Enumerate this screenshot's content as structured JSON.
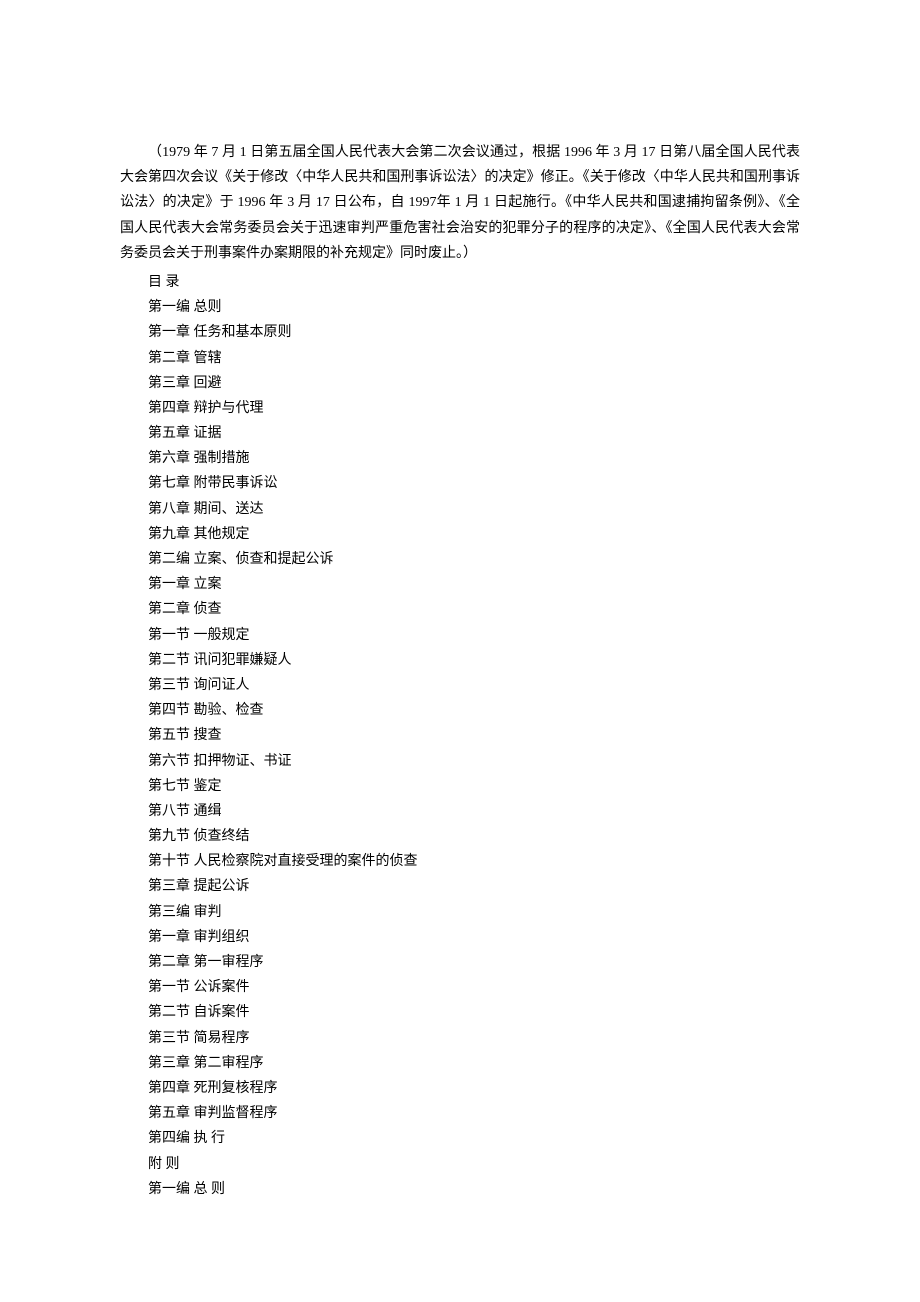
{
  "intro": "（1979 年 7 月 1 日第五届全国人民代表大会第二次会议通过，根据 1996 年 3 月 17 日第八届全国人民代表大会第四次会议《关于修改〈中华人民共和国刑事诉讼法〉的决定》修正。《关于修改〈中华人民共和国刑事诉讼法〉的决定》于 1996 年 3 月 17 日公布，自 1997年 1 月 1 日起施行。《中华人民共和国逮捕拘留条例》、《全国人民代表大会常务委员会关于迅速审判严重危害社会治安的犯罪分子的程序的决定》、《全国人民代表大会常务委员会关于刑事案件办案期限的补充规定》同时废止。）",
  "toc": [
    "目  录",
    "第一编  总则",
    "第一章  任务和基本原则",
    "第二章  管辖",
    "第三章  回避",
    "第四章  辩护与代理",
    "第五章  证据",
    "第六章  强制措施",
    "第七章  附带民事诉讼",
    "第八章  期间、送达",
    "第九章  其他规定",
    "第二编  立案、侦查和提起公诉",
    "第一章  立案",
    "第二章  侦查",
    "第一节  一般规定",
    "第二节  讯问犯罪嫌疑人",
    "第三节  询问证人",
    "第四节  勘验、检查",
    "第五节  搜查",
    "第六节  扣押物证、书证",
    "第七节  鉴定",
    "第八节  通缉",
    "第九节  侦查终结",
    "第十节  人民检察院对直接受理的案件的侦查",
    "第三章  提起公诉",
    "第三编  审判",
    "第一章  审判组织",
    "第二章  第一审程序",
    "第一节  公诉案件",
    "第二节  自诉案件",
    "第三节  简易程序",
    "第三章  第二审程序",
    "第四章  死刑复核程序",
    "第五章  审判监督程序",
    "第四编  执  行",
    "附  则",
    "第一编  总  则"
  ]
}
